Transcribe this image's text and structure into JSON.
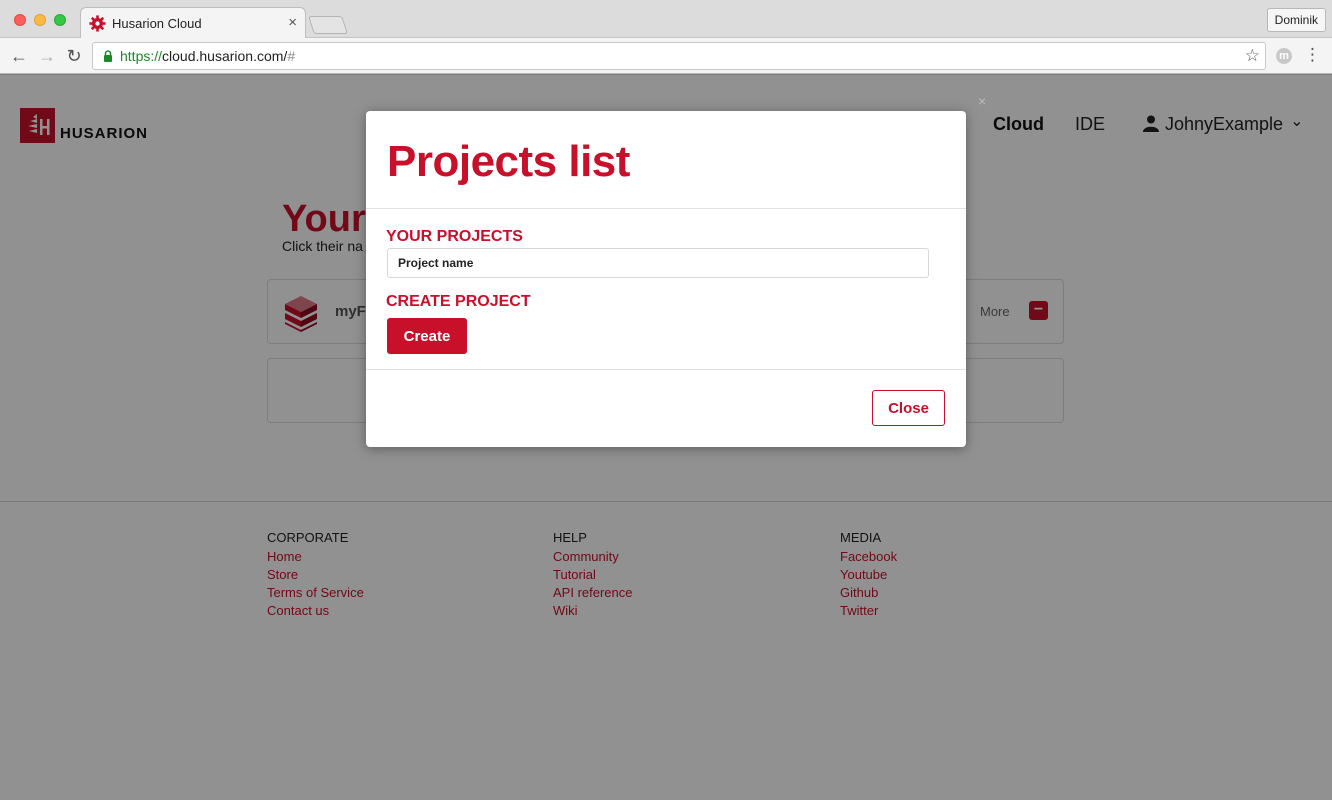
{
  "browser": {
    "tab_title": "Husarion Cloud",
    "tab_close": "×",
    "profile": "Dominik",
    "url_scheme": "https://",
    "url_host": "cloud.husarion.com/",
    "url_hash": "#"
  },
  "header": {
    "logo_text": "HUSARION",
    "nav_cloud": "Cloud",
    "nav_ide": "IDE",
    "username": "JohnyExample",
    "chevron": "⌄"
  },
  "main": {
    "title": "Your",
    "subtitle": "Click their na",
    "project_card": {
      "name": "myFi",
      "more_label": "More",
      "remove_label": "−"
    }
  },
  "footer": {
    "columns": [
      {
        "heading": "CORPORATE",
        "links": [
          "Home",
          "Store",
          "Terms of Service",
          "Contact us"
        ]
      },
      {
        "heading": "HELP",
        "links": [
          "Community",
          "Tutorial",
          "API reference",
          "Wiki"
        ]
      },
      {
        "heading": "MEDIA",
        "links": [
          "Facebook",
          "Youtube",
          "Github",
          "Twitter"
        ]
      }
    ]
  },
  "modal": {
    "title": "Projects list",
    "your_projects_heading": "YOUR PROJECTS",
    "project_name_placeholder": "Project name",
    "create_project_heading": "CREATE PROJECT",
    "create_label": "Create",
    "close_label": "Close",
    "dismiss": "×"
  },
  "colors": {
    "brand": "#c9102b",
    "overlay": "rgba(0,0,0,0.43)"
  }
}
